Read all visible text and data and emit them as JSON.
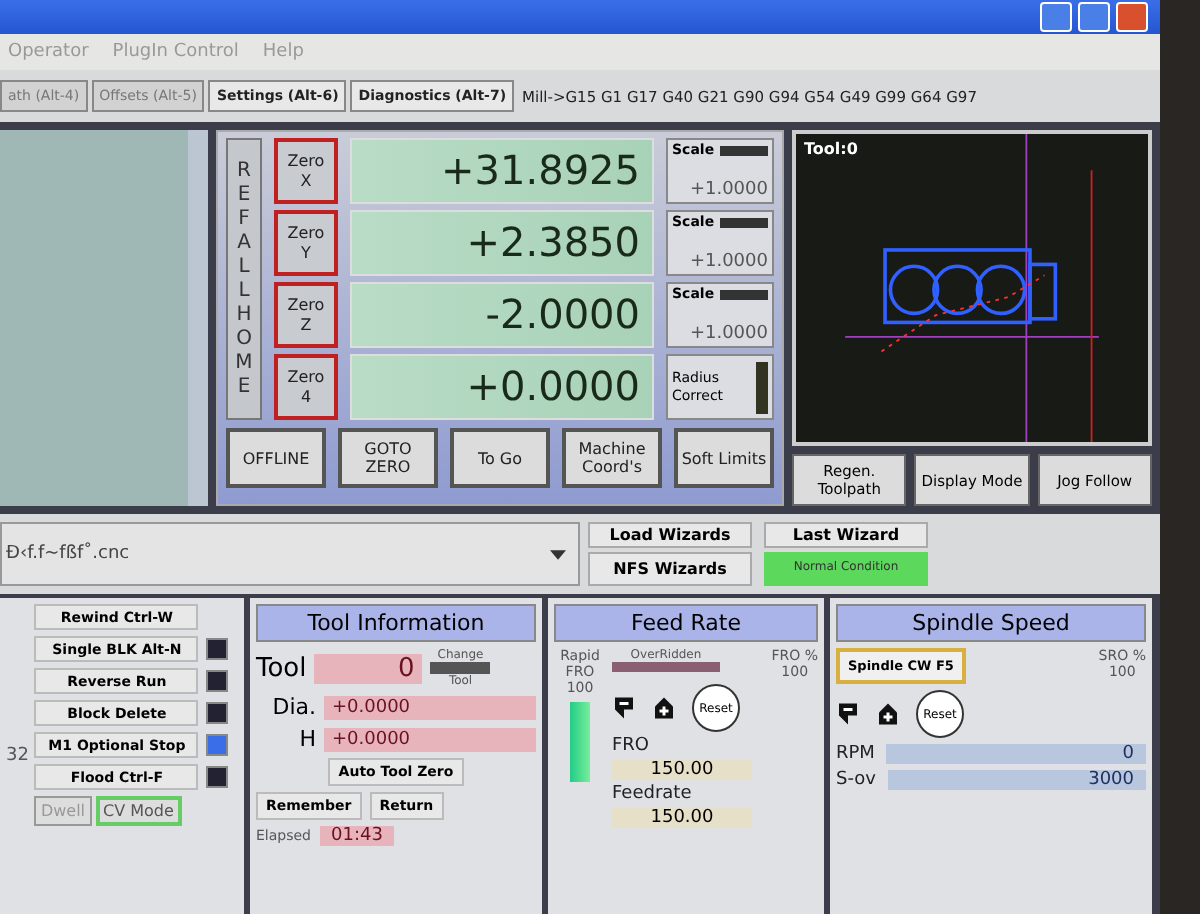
{
  "menu": [
    {
      "label": "Operator"
    },
    {
      "label": "PlugIn Control"
    },
    {
      "label": "Help"
    }
  ],
  "tabs": [
    {
      "label": "ath (Alt-4)",
      "disabled": true
    },
    {
      "label": "Offsets (Alt-5)",
      "disabled": true
    },
    {
      "label": "Settings (Alt-6)",
      "disabled": false
    },
    {
      "label": "Diagnostics (Alt-7)",
      "disabled": false
    }
  ],
  "modal_line": "Mill->G15  G1 G17 G40 G21 G90 G94 G54 G49 G99 G64 G97",
  "ref_all_home": "REF ALL HOME",
  "axes": [
    {
      "zero": "Zero",
      "axis": "X",
      "value": "+31.8925",
      "scale_label": "Scale",
      "scale": "+1.0000"
    },
    {
      "zero": "Zero",
      "axis": "Y",
      "value": "+2.3850",
      "scale_label": "Scale",
      "scale": "+1.0000"
    },
    {
      "zero": "Zero",
      "axis": "Z",
      "value": "-2.0000",
      "scale_label": "Scale",
      "scale": "+1.0000"
    },
    {
      "zero": "Zero",
      "axis": "4",
      "value": "+0.0000"
    }
  ],
  "radius_correct": {
    "label": "Radius Correct",
    "on": false
  },
  "dro_buttons": [
    "OFFLINE",
    "GOTO ZERO",
    "To Go",
    "Machine Coord's",
    "Soft Limits"
  ],
  "toolpath": {
    "label": "Tool:0"
  },
  "toolpath_buttons": [
    "Regen. Toolpath",
    "Display Mode",
    "Jog Follow"
  ],
  "file": "Ð‹f.f~fßf˚.cnc",
  "wizards": [
    "Load Wizards",
    "Last Wizard",
    "NFS Wizards"
  ],
  "status": "Normal Condition",
  "left_number": "32",
  "rewind": "Rewind Ctrl-W",
  "toggles": [
    {
      "label": "Single BLK Alt-N",
      "on": false
    },
    {
      "label": "Reverse Run",
      "on": false
    },
    {
      "label": "Block Delete",
      "on": false
    },
    {
      "label": "M1 Optional Stop",
      "on": true
    },
    {
      "label": "Flood Ctrl-F",
      "on": false
    }
  ],
  "modes": [
    {
      "label": "Dwell",
      "on": false
    },
    {
      "label": "CV Mode",
      "on": true
    }
  ],
  "tool_info": {
    "title": "Tool Information",
    "tool_label": "Tool",
    "tool": "0",
    "change_top": "Change",
    "change_bottom": "Tool",
    "dia_label": "Dia.",
    "dia": "+0.0000",
    "h_label": "H",
    "h": "+0.0000",
    "auto_zero": "Auto Tool Zero",
    "remember": "Remember",
    "return": "Return",
    "elapsed_label": "Elapsed",
    "elapsed": "01:43"
  },
  "feed": {
    "title": "Feed Rate",
    "overridden": "OverRidden",
    "pct_label": "FRO %",
    "pct": "100",
    "rapid_label": "Rapid FRO",
    "rapid": "100",
    "reset": "Reset",
    "fro_label": "FRO",
    "fro": "150.00",
    "feedrate_label": "Feedrate",
    "feedrate": "150.00"
  },
  "spindle": {
    "title": "Spindle Speed",
    "direction": "Spindle CW F5",
    "pct_label": "SRO %",
    "pct": "100",
    "reset": "Reset",
    "rpm_label": "RPM",
    "rpm": "0",
    "sov_label": "S-ov",
    "sov": "3000"
  }
}
